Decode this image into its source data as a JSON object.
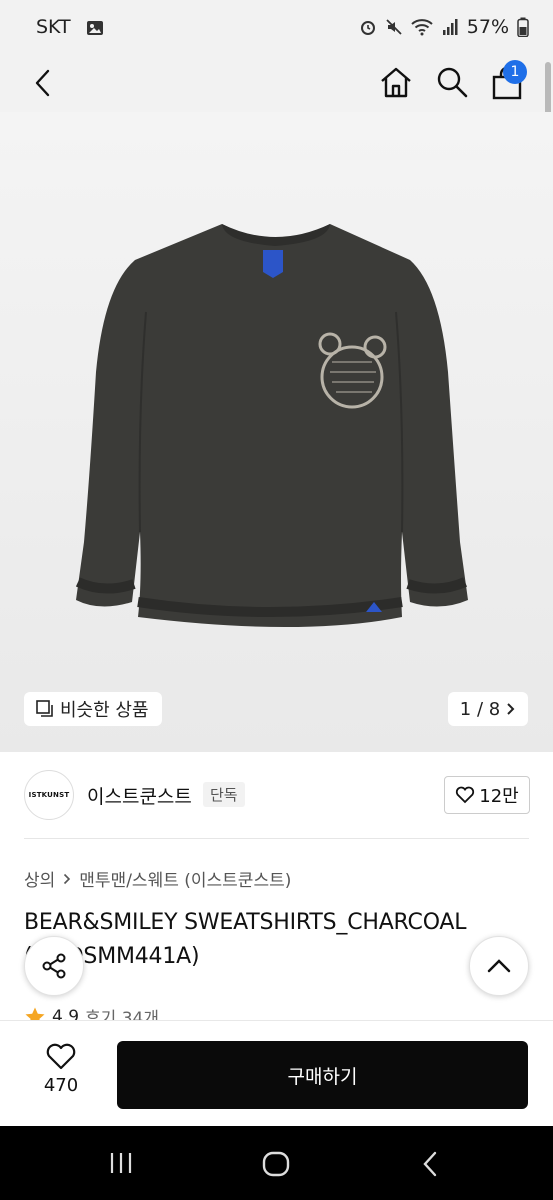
{
  "status_bar": {
    "carrier": "SKT",
    "battery": "57%"
  },
  "product": {
    "image_caption_button": "비슷한 상품",
    "image_counter": "1 / 8",
    "seller_logo_text": "ISTKUNST",
    "seller_name": "이스트쿤스트",
    "seller_badge": "단독",
    "likes": "12만",
    "breadcrumb_root": "상의",
    "breadcrumb_sub": "맨투맨/스웨트 (이스트쿤스트)",
    "title": "BEAR&SMILEY SWEATSHIRTS_CHARCOAL (IK2DSMM441A)",
    "rating_score": "4.9",
    "review_label": "후기 34개"
  },
  "header": {
    "cart_count": "1"
  },
  "bottom_bar": {
    "wish_count": "470",
    "buy_label": "구매하기"
  },
  "colors": {
    "accent_badge": "#1f6fe8",
    "buy_button": "#0a0a0a",
    "star": "#f5a623"
  },
  "icons": [
    "back-icon",
    "home-icon",
    "search-icon",
    "cart-icon",
    "similar-icon",
    "chevron-right-icon",
    "heart-icon",
    "share-icon",
    "chevron-up-icon",
    "star-icon",
    "recents-icon",
    "nav-home-icon",
    "nav-back-icon"
  ]
}
